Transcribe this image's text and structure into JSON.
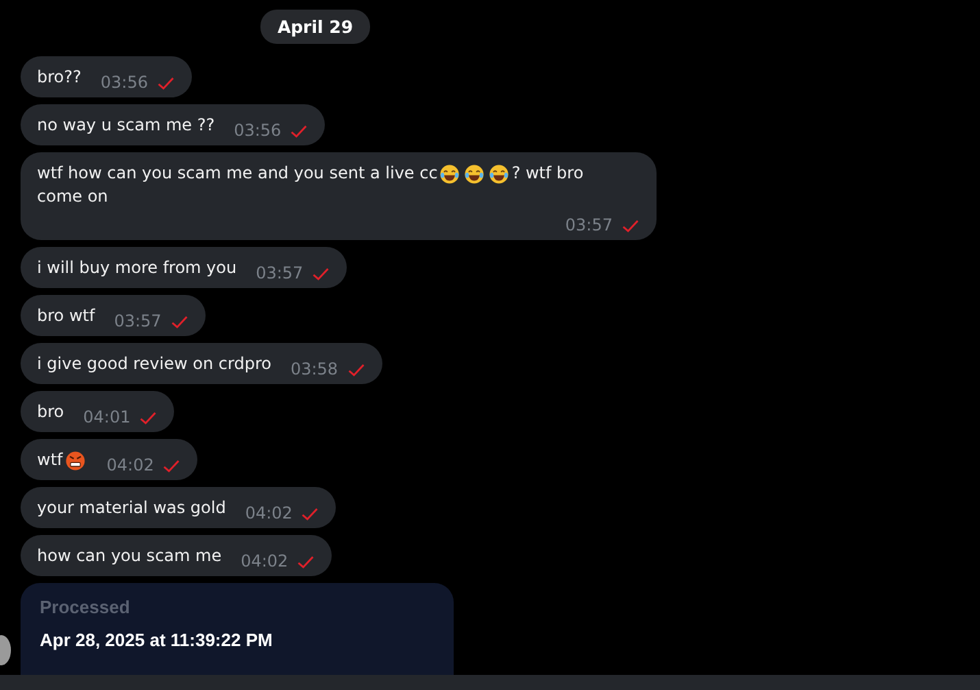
{
  "date_badge": "April 29",
  "messages": [
    {
      "parts": [
        {
          "kind": "text",
          "text": "bro??"
        }
      ],
      "time": "03:56",
      "read": false
    },
    {
      "parts": [
        {
          "kind": "text",
          "text": "no way u scam me ??"
        }
      ],
      "time": "03:56",
      "read": false
    },
    {
      "parts": [
        {
          "kind": "text",
          "text": "wtf how can you scam me and you sent a live cc"
        },
        {
          "kind": "laugh"
        },
        {
          "kind": "laugh"
        },
        {
          "kind": "laugh"
        },
        {
          "kind": "text",
          "text": "? wtf bro"
        },
        {
          "kind": "break"
        },
        {
          "kind": "text",
          "text": "come on"
        }
      ],
      "time": "03:57",
      "read": false
    },
    {
      "parts": [
        {
          "kind": "text",
          "text": "i will buy more from you"
        }
      ],
      "time": "03:57",
      "read": false
    },
    {
      "parts": [
        {
          "kind": "text",
          "text": "bro wtf"
        }
      ],
      "time": "03:57",
      "read": false
    },
    {
      "parts": [
        {
          "kind": "text",
          "text": "i give good review on crdpro"
        }
      ],
      "time": "03:58",
      "read": false
    },
    {
      "parts": [
        {
          "kind": "text",
          "text": "bro"
        }
      ],
      "time": "04:01",
      "read": false
    },
    {
      "parts": [
        {
          "kind": "text",
          "text": "wtf"
        },
        {
          "kind": "angry"
        }
      ],
      "time": "04:02",
      "read": false
    },
    {
      "parts": [
        {
          "kind": "text",
          "text": "your material was gold"
        }
      ],
      "time": "04:02",
      "read": false
    },
    {
      "parts": [
        {
          "kind": "text",
          "text": "how can you scam me"
        }
      ],
      "time": "04:02",
      "read": false
    }
  ],
  "card": {
    "label": "Processed",
    "value": "Apr 28, 2025 at 11:39:22 PM"
  }
}
